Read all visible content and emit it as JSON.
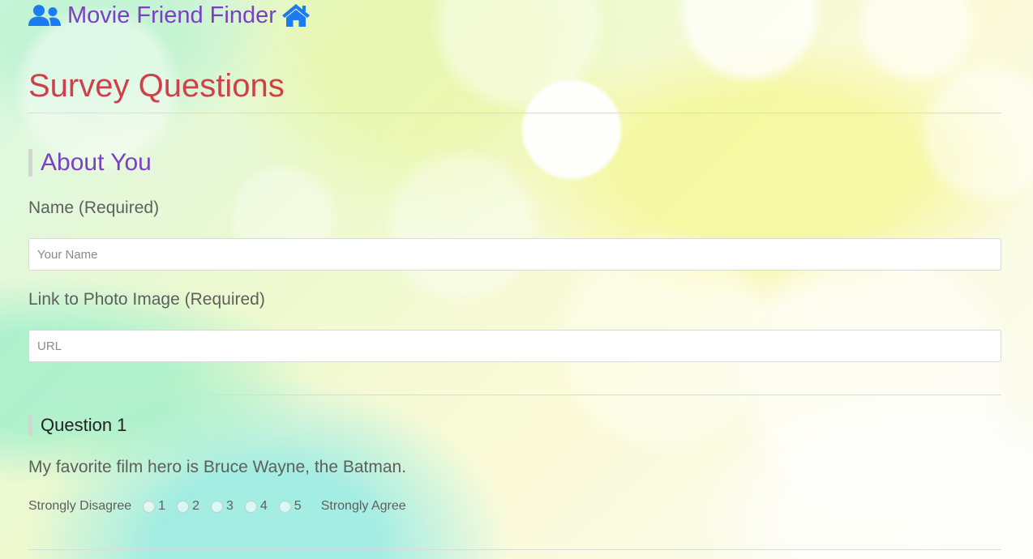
{
  "brand": {
    "title": "Movie Friend Finder",
    "left_icon": "users-icon",
    "right_icon": "home-icon",
    "color": "#7b3fc4",
    "icon_color": "#1a7cf0"
  },
  "page": {
    "title": "Survey Questions",
    "title_color": "#d0404a"
  },
  "about": {
    "heading": "About You",
    "name_label": "Name (Required)",
    "name_placeholder": "Your Name",
    "name_value": "",
    "photo_label": "Link to Photo Image (Required)",
    "photo_placeholder": "URL",
    "photo_value": ""
  },
  "question1": {
    "heading": "Question 1",
    "text": "My favorite film hero is Bruce Wayne, the Batman.",
    "low_label": "Strongly Disagree",
    "high_label": "Strongly Agree",
    "options": [
      "1",
      "2",
      "3",
      "4",
      "5"
    ],
    "selected": null
  }
}
